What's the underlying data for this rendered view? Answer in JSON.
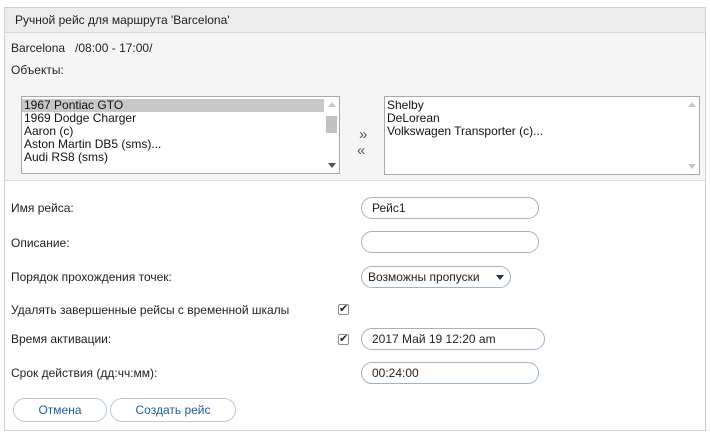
{
  "dialog": {
    "title": "Ручной рейс для маршрута 'Barcelona'"
  },
  "route_info": "Barcelona   /08:00 - 17:00/",
  "objects": {
    "label": "Объекты:",
    "available": [
      {
        "label": "1967 Pontiac GTO",
        "selected": true
      },
      {
        "label": "1969 Dodge Charger",
        "selected": false
      },
      {
        "label": "Aaron (c)",
        "selected": false
      },
      {
        "label": "Aston Martin DB5 (sms)...",
        "selected": false
      },
      {
        "label": "Audi RS8 (sms)",
        "selected": false
      }
    ],
    "chosen": [
      {
        "label": "Shelby"
      },
      {
        "label": "DeLorean"
      },
      {
        "label": "Volkswagen Transporter (c)..."
      }
    ],
    "add_glyph": "»",
    "remove_glyph": "«"
  },
  "form": {
    "trip_name_label": "Имя рейса:",
    "trip_name_value": "Рейс1",
    "description_label": "Описание:",
    "description_value": "",
    "order_label": "Порядок прохождения точек:",
    "order_value": "Возможны пропуски",
    "delete_finished_label": "Удалять завершенные рейсы с временной шкалы",
    "delete_finished_checked": true,
    "activation_label": "Время активации:",
    "activation_checked": true,
    "activation_value": "2017 Май 19 12:20 am",
    "validity_label": "Срок действия (дд:чч:мм):",
    "validity_value": "00:24:00"
  },
  "buttons": {
    "cancel": "Отмена",
    "create": "Создать рейс"
  },
  "colors": {
    "accent": "#1f5b98",
    "border": "#9fb3c6"
  }
}
